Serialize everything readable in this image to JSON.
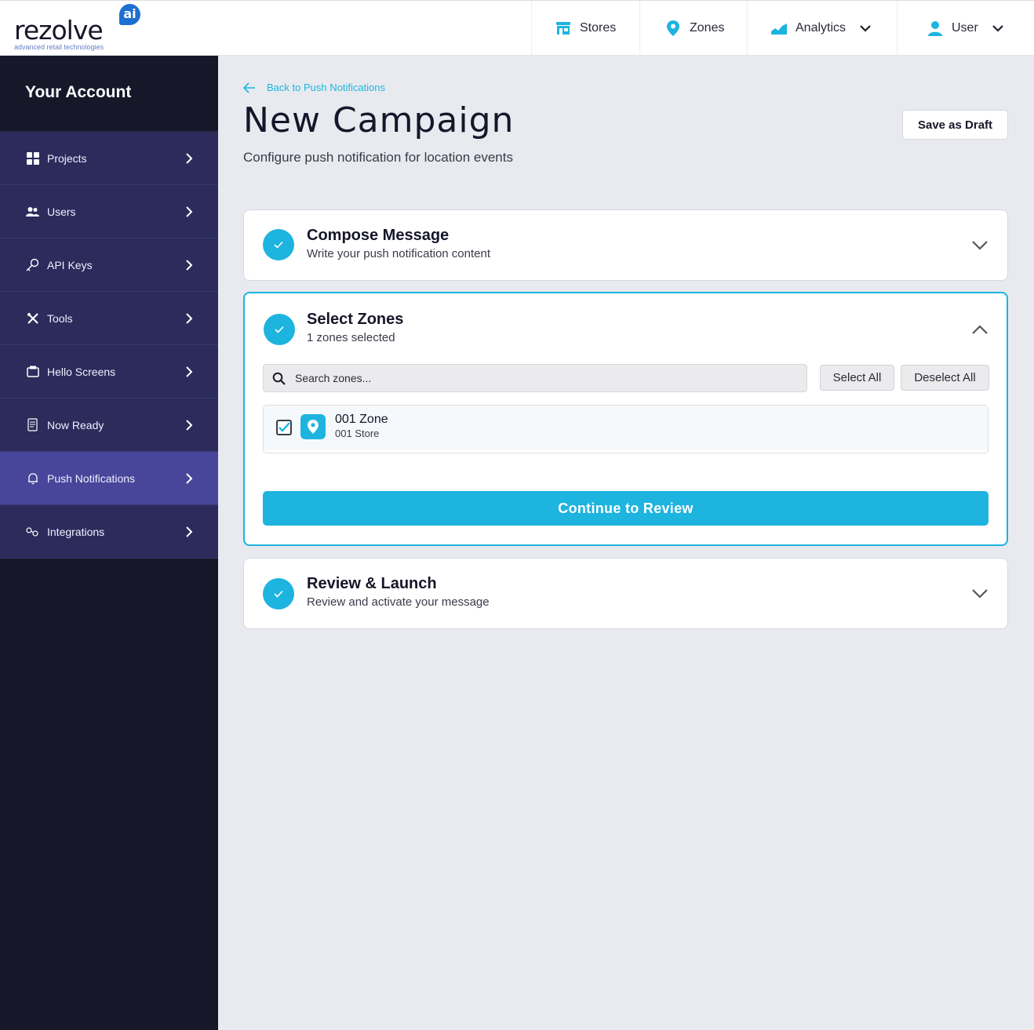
{
  "brand": {
    "name": "rezolve",
    "badge": "ai",
    "tagline": "advanced retail technologies",
    "accent": "#1db4df",
    "sidebar_bg": "#17172a",
    "sidebar_item_bg": "#2c2b5c",
    "sidebar_active_bg": "#48469a"
  },
  "topnav": {
    "stores": {
      "label": "Stores",
      "icon": "store-icon"
    },
    "zones": {
      "label": "Zones",
      "icon": "location-pin-icon"
    },
    "analytics": {
      "label": "Analytics",
      "icon": "chart-icon"
    },
    "user": {
      "label": "User",
      "icon": "user-icon"
    }
  },
  "sidebar": {
    "title": "Your Account",
    "items": [
      {
        "label": "Projects",
        "icon": "grid-icon",
        "active": false
      },
      {
        "label": "Users",
        "icon": "users-icon",
        "active": false
      },
      {
        "label": "API Keys",
        "icon": "key-icon",
        "active": false
      },
      {
        "label": "Tools",
        "icon": "tools-icon",
        "active": false
      },
      {
        "label": "Hello Screens",
        "icon": "window-icon",
        "active": false
      },
      {
        "label": "Now Ready",
        "icon": "document-icon",
        "active": false
      },
      {
        "label": "Push Notifications",
        "icon": "bell-icon",
        "active": true
      },
      {
        "label": "Integrations",
        "icon": "integrations-icon",
        "active": false
      }
    ]
  },
  "main": {
    "back_link": "Back to Push Notifications",
    "title": "New Campaign",
    "subtitle": "Configure push notification for location events",
    "save_draft": "Save as Draft",
    "steps": {
      "compose": {
        "title": "Compose Message",
        "subtitle": "Write your push notification content"
      },
      "zones": {
        "title": "Select Zones",
        "subtitle": "1 zones selected",
        "search_placeholder": "Search zones...",
        "select_all": "Select All",
        "deselect_all": "Deselect All",
        "zone_list": [
          {
            "name": "001 Zone",
            "store": "001 Store",
            "checked": true
          }
        ],
        "continue": "Continue to Review"
      },
      "review": {
        "title": "Review & Launch",
        "subtitle": "Review and activate your message"
      }
    }
  }
}
